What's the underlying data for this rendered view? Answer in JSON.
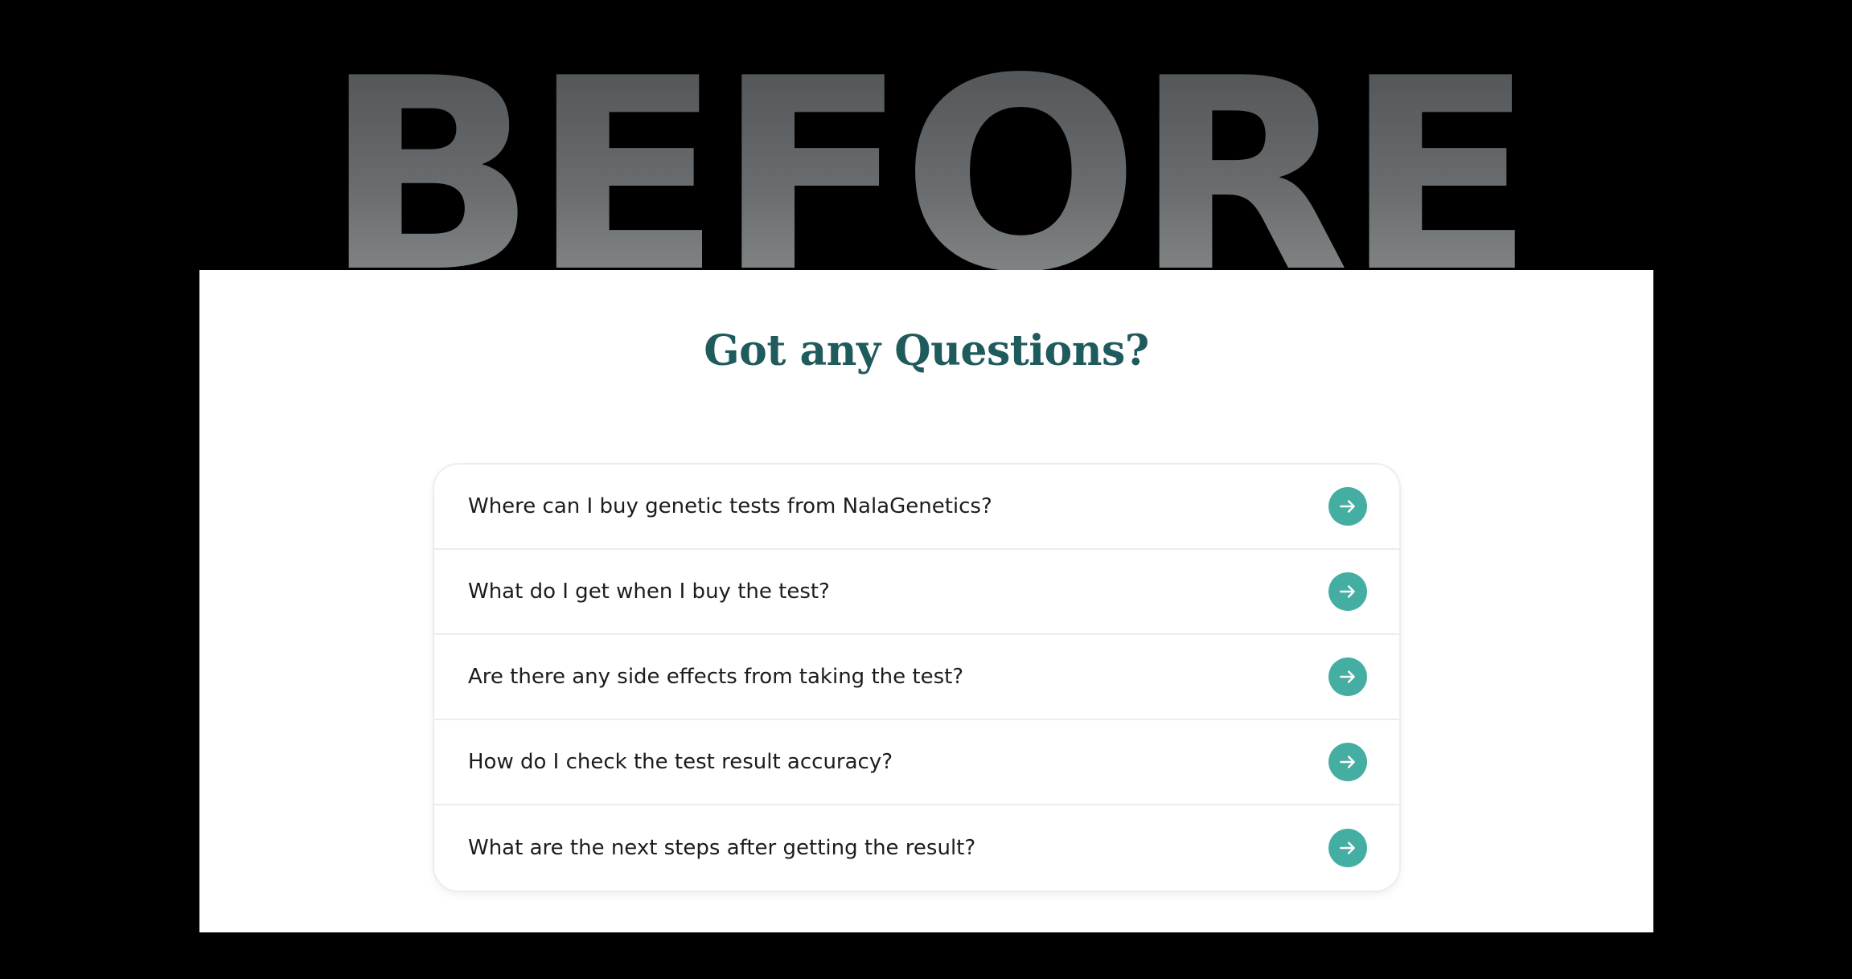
{
  "hero": {
    "word": "BEFORE"
  },
  "section": {
    "heading": "Got any Questions?"
  },
  "faq": {
    "items": [
      {
        "question": "Where can I buy genetic tests from NalaGenetics?"
      },
      {
        "question": "What do I get when I buy the test?"
      },
      {
        "question": "Are there any side effects from taking the test?"
      },
      {
        "question": "How do I check the test result accuracy?"
      },
      {
        "question": "What are the next steps after getting the result?"
      }
    ],
    "icon": "arrow-right-circle-icon"
  },
  "colors": {
    "background": "#000000",
    "panel": "#ffffff",
    "heading": "#1f5a5c",
    "accent": "#45aea2",
    "question_text": "#1c1c1c"
  }
}
